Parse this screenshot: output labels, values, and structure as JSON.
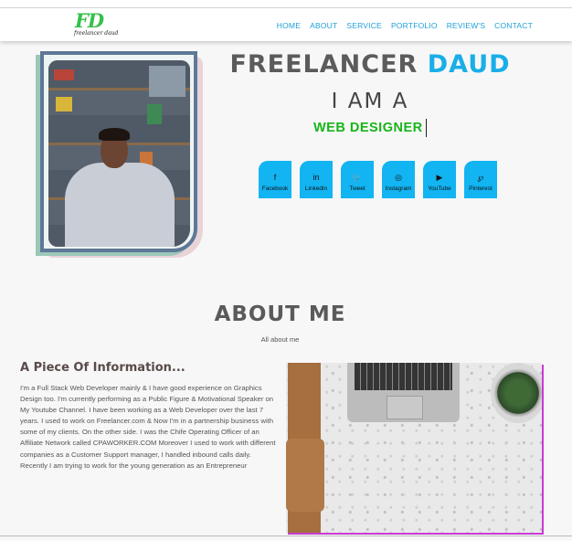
{
  "brand": {
    "logo_mark": "FD",
    "logo_sub": "freelancer daud"
  },
  "nav": [
    "HOME",
    "ABOUT",
    "SERVICE",
    "PORTFOLIO",
    "REVIEW'S",
    "CONTACT"
  ],
  "hero": {
    "title_main": "FREELANCER",
    "title_highlight": "DAUD",
    "intro": "I AM A",
    "role": "WEB DESIGNER"
  },
  "social": [
    {
      "label": "Facebook",
      "icon": "facebook-icon",
      "glyph": "f"
    },
    {
      "label": "Linkedin",
      "icon": "linkedin-icon",
      "glyph": "in"
    },
    {
      "label": "Tweet",
      "icon": "twitter-icon",
      "glyph": "🐦"
    },
    {
      "label": "Instagram",
      "icon": "instagram-icon",
      "glyph": "◎"
    },
    {
      "label": "YouTube",
      "icon": "youtube-icon",
      "glyph": "▶"
    },
    {
      "label": "Pinterest",
      "icon": "pinterest-icon",
      "glyph": "℘"
    }
  ],
  "about": {
    "title": "ABOUT ME",
    "subtitle": "All about me",
    "heading": "A Piece Of Information...",
    "paragraph": "I'm a Full Stack Web Developer mainly & I have good experience on Graphics Design too. I'm currently performing as a Public Figure & Motivational Speaker on My Youtube Channel. I have been working as a Web Developer over the last 7 years. I used to work on Freelancer.com & Now I'm in a partnership business with some of my clients. On the other side. I was the Chife Operating Officer of an Affiliate Network called CPAWORKER.COM Moreover I used to work with different companies as a Customer Support manager, I handled inbound calls daily. Recently I am trying to work for the young generation as an Entrepreneur"
  },
  "colors": {
    "accent": "#12b4f2",
    "role": "#18b51a",
    "logo": "#35c04a",
    "frame": "#5e7897",
    "image_border": "#c93ad6"
  }
}
